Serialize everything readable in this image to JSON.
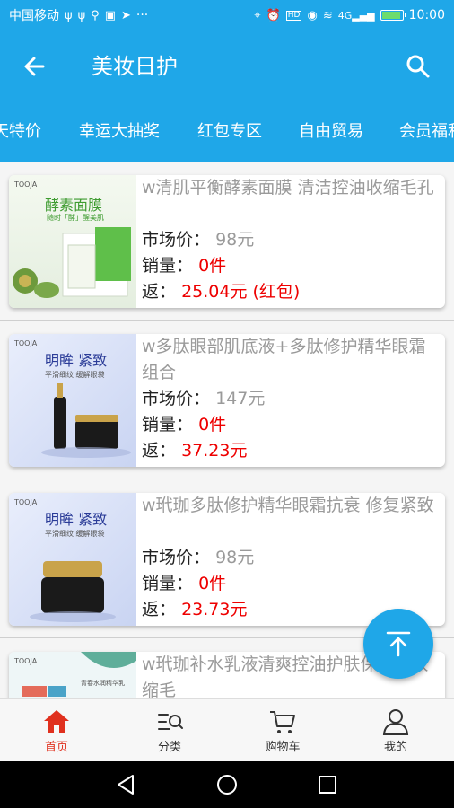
{
  "status_bar": {
    "carrier": "中国移动",
    "icons_left": [
      "usb-icon",
      "usb-icon",
      "search-icon",
      "image-icon",
      "send-icon"
    ],
    "dots": "···",
    "icons_right": [
      "location-icon",
      "alarm-icon",
      "hd-icon",
      "eye-icon",
      "wifi-icon",
      "signal-icon",
      "battery-icon"
    ],
    "network": "4G",
    "time": "10:00",
    "battery_level": 0.85
  },
  "header": {
    "title": "美妆日护",
    "back_icon": "back-arrow-icon",
    "search_icon": "search-icon"
  },
  "tabs": [
    "天特价",
    "幸运大抽奖",
    "红包专区",
    "自由贸易",
    "会员福利"
  ],
  "products": [
    {
      "name": "w清肌平衡酵素面膜 清洁控油收缩毛孔",
      "market_label": "市场价：",
      "market_price": "98元",
      "sales_label": "销量：",
      "sales": "0件",
      "rebate_label": "返：",
      "rebate": "25.04元",
      "rebate_note": "(红包)",
      "thumb": {
        "brand": "TOOJA",
        "headline": "酵素面膜",
        "sub": "随时「酵」醒美肌"
      }
    },
    {
      "name": "w多肽眼部肌底液+多肽修护精华眼霜组合",
      "market_label": "市场价：",
      "market_price": "147元",
      "sales_label": "销量：",
      "sales": "0件",
      "rebate_label": "返：",
      "rebate": "37.23元",
      "rebate_note": "",
      "thumb": {
        "brand": "TOOJA",
        "headline": "明眸 紧致",
        "sub": "平滑细纹  缓解眼袋"
      }
    },
    {
      "name": "w玳珈多肽修护精华眼霜抗衰 修复紧致",
      "market_label": "市场价：",
      "market_price": "98元",
      "sales_label": "销量：",
      "sales": "0件",
      "rebate_label": "返：",
      "rebate": "23.73元",
      "rebate_note": "",
      "thumb": {
        "brand": "TOOJA",
        "headline": "明眸 紧致",
        "sub": "平滑细纹  缓解眼袋"
      }
    },
    {
      "name": "w玳珈补水乳液清爽控油护肤保湿乳收缩毛",
      "market_label": "",
      "market_price": "",
      "sales_label": "",
      "sales": "",
      "rebate_label": "",
      "rebate": "",
      "rebate_note": "",
      "thumb": {
        "brand": "TOOJA",
        "headline": "",
        "sub": "青春水润精华乳"
      }
    }
  ],
  "fab_icon": "arrow-up-icon",
  "bottom_nav": [
    {
      "label": "首页",
      "icon": "home-icon",
      "active": true
    },
    {
      "label": "分类",
      "icon": "category-icon",
      "active": false
    },
    {
      "label": "购物车",
      "icon": "cart-icon",
      "active": false
    },
    {
      "label": "我的",
      "icon": "profile-icon",
      "active": false
    }
  ],
  "colors": {
    "primary": "#1fa7e8",
    "price_red": "#e00000",
    "nav_active": "#e0301e"
  }
}
